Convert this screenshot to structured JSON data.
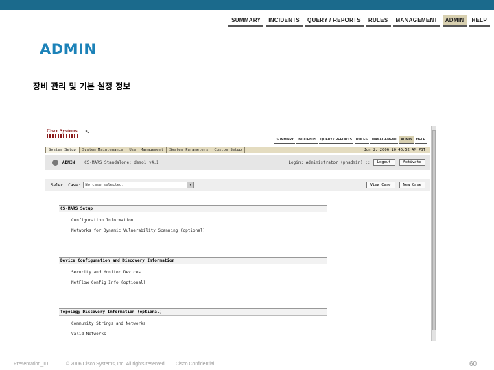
{
  "slide_nav": [
    "SUMMARY",
    "INCIDENTS",
    "QUERY / REPORTS",
    "RULES",
    "MANAGEMENT",
    "ADMIN",
    "HELP"
  ],
  "slide_nav_active": "ADMIN",
  "title": "ADMIN",
  "subtitle": "장비 관리 및 기본 설정 정보",
  "shot": {
    "logo": "Cisco Systems",
    "nav": [
      "SUMMARY",
      "INCIDENTS",
      "QUERY / REPORTS",
      "RULES",
      "MANAGEMENT",
      "ADMIN",
      "HELP"
    ],
    "nav_active": "ADMIN",
    "tabs": [
      "System Setup",
      "System Maintenance",
      "User Management",
      "System Parameters",
      "Custom Setup"
    ],
    "timestamp": "Jun 2, 2006 10:46:52 AM PST",
    "page_label": "ADMIN",
    "device_name": "CS-MARS Standalone: demo1 v4.1",
    "login_info": "Login: Administrator (pnadmin) ::",
    "logout_label": "Logout",
    "activate_label": "Activate",
    "select_label": "Select Case:",
    "select_value": "No case selected.",
    "view_case_label": "View Case",
    "new_case_label": "New Case",
    "sections": [
      {
        "heading": "CS-MARS Setup",
        "links": [
          "Configuration Information",
          "Networks for Dynamic Vulnerability Scanning (optional)"
        ]
      },
      {
        "heading": "Device Configuration and Discovery Information",
        "links": [
          "Security and Monitor Devices",
          "NetFlow Config Info (optional)"
        ]
      },
      {
        "heading": "Topology Discovery Information (optional)",
        "links": [
          "Community Strings and Networks",
          "Valid Networks"
        ]
      }
    ]
  },
  "footer": {
    "presentation_id": "Presentation_ID",
    "copyright": "© 2006 Cisco Systems, Inc. All rights reserved.",
    "confidential": "Cisco Confidential",
    "page_number": "60"
  }
}
